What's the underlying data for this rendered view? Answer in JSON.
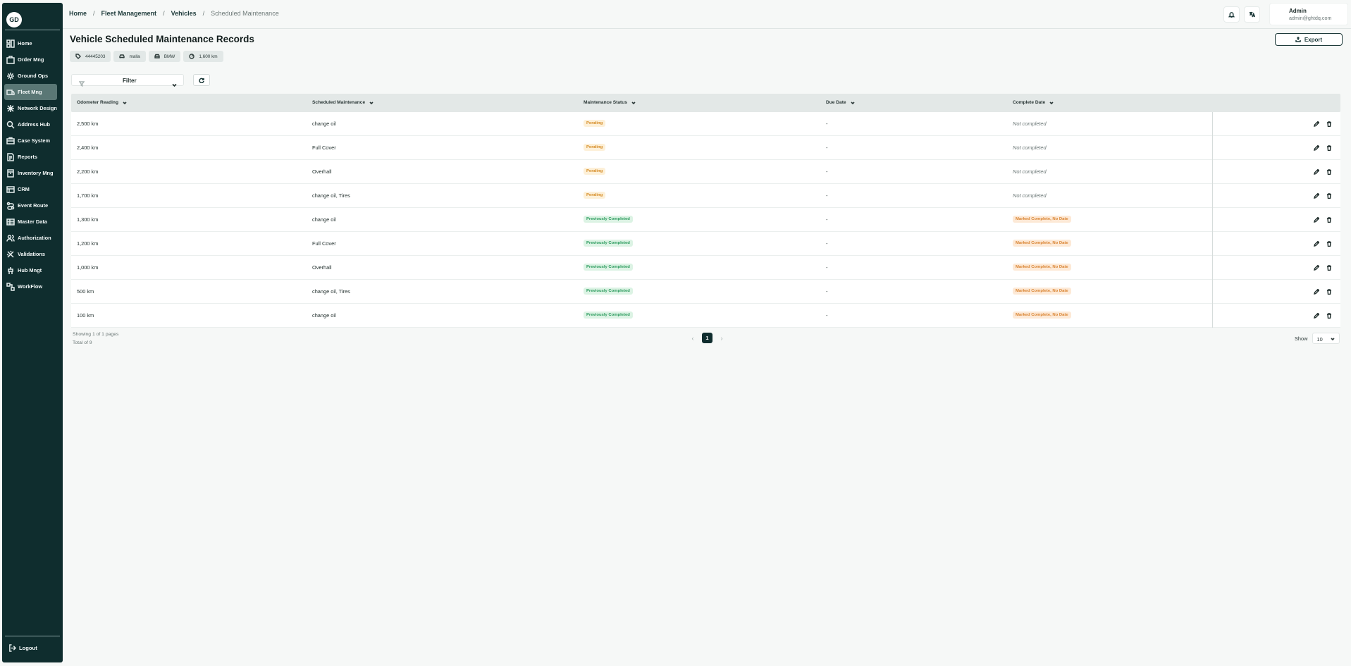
{
  "sidebar": {
    "logo": "GD",
    "items": [
      {
        "label": "Home",
        "icon": "home-icon",
        "active": false
      },
      {
        "label": "Order Mng",
        "icon": "order-icon",
        "active": false
      },
      {
        "label": "Ground Ops",
        "icon": "ground-ops-icon",
        "active": false
      },
      {
        "label": "Fleet Mng",
        "icon": "truck-icon",
        "active": true
      },
      {
        "label": "Network Design",
        "icon": "network-icon",
        "active": false
      },
      {
        "label": "Address Hub",
        "icon": "map-pin-icon",
        "active": false
      },
      {
        "label": "Case System",
        "icon": "case-icon",
        "active": false
      },
      {
        "label": "Reports",
        "icon": "report-icon",
        "active": false
      },
      {
        "label": "Inventory Mng",
        "icon": "inventory-icon",
        "active": false
      },
      {
        "label": "CRM",
        "icon": "crm-icon",
        "active": false
      },
      {
        "label": "Event Route",
        "icon": "route-icon",
        "active": false
      },
      {
        "label": "Master Data",
        "icon": "database-icon",
        "active": false
      },
      {
        "label": "Authorization",
        "icon": "users-icon",
        "active": false
      },
      {
        "label": "Validations",
        "icon": "validation-icon",
        "active": false
      },
      {
        "label": "Hub Mngt",
        "icon": "hub-icon",
        "active": false
      },
      {
        "label": "WorkFlow",
        "icon": "workflow-icon",
        "active": false
      }
    ],
    "logout_label": "Logout"
  },
  "header": {
    "breadcrumb": [
      "Home",
      "Fleet Management",
      "Vehicles",
      "Scheduled Maintenance"
    ],
    "user_name": "Admin",
    "user_email": "admin@ghtdq.com"
  },
  "page": {
    "title": "Vehicle Scheduled Maintenance Records",
    "export_label": "Export"
  },
  "vehicle_chips": [
    {
      "icon": "tag-icon",
      "value": "44445203"
    },
    {
      "icon": "car-icon",
      "value": "malla"
    },
    {
      "icon": "car-front-icon",
      "value": "BMW"
    },
    {
      "icon": "gauge-icon",
      "value": "1,600 km"
    }
  ],
  "filter": {
    "label": "Filter"
  },
  "table": {
    "columns": [
      "Odometer Reading",
      "Scheduled Maintenance",
      "Maintenance Status",
      "Due Date",
      "Complete Date"
    ],
    "rows": [
      {
        "odometer": "2,500 km",
        "maintenance": "change oil",
        "status": "Pending",
        "status_type": "pending",
        "due": "-",
        "complete": "Not completed",
        "complete_type": "muted"
      },
      {
        "odometer": "2,400 km",
        "maintenance": "Full Cover",
        "status": "Pending",
        "status_type": "pending",
        "due": "-",
        "complete": "Not completed",
        "complete_type": "muted"
      },
      {
        "odometer": "2,200 km",
        "maintenance": "Overhall",
        "status": "Pending",
        "status_type": "pending",
        "due": "-",
        "complete": "Not completed",
        "complete_type": "muted"
      },
      {
        "odometer": "1,700 km",
        "maintenance": "change oil, Tires",
        "status": "Pending",
        "status_type": "pending",
        "due": "-",
        "complete": "Not completed",
        "complete_type": "muted"
      },
      {
        "odometer": "1,300 km",
        "maintenance": "change oil",
        "status": "Previously Completed",
        "status_type": "done",
        "due": "-",
        "complete": "Marked Complete, No Date",
        "complete_type": "marked"
      },
      {
        "odometer": "1,200 km",
        "maintenance": "Full Cover",
        "status": "Previously Completed",
        "status_type": "done",
        "due": "-",
        "complete": "Marked Complete, No Date",
        "complete_type": "marked"
      },
      {
        "odometer": "1,000 km",
        "maintenance": "Overhall",
        "status": "Previously Completed",
        "status_type": "done",
        "due": "-",
        "complete": "Marked Complete, No Date",
        "complete_type": "marked"
      },
      {
        "odometer": "500 km",
        "maintenance": "change oil, Tires",
        "status": "Previously Completed",
        "status_type": "done",
        "due": "-",
        "complete": "Marked Complete, No Date",
        "complete_type": "marked"
      },
      {
        "odometer": "100 km",
        "maintenance": "change oil",
        "status": "Previously Completed",
        "status_type": "done",
        "due": "-",
        "complete": "Marked Complete, No Date",
        "complete_type": "marked"
      }
    ]
  },
  "pagination": {
    "showing": "Showing 1 of 1 pages",
    "total": "Total of 9",
    "current_page": "1",
    "show_label": "Show",
    "page_size": "10"
  },
  "colors": {
    "sidebar_bg": "#0f2d2e",
    "active_item": "#5a7775",
    "pending": "#d58a22",
    "completed": "#2b9b5d"
  }
}
